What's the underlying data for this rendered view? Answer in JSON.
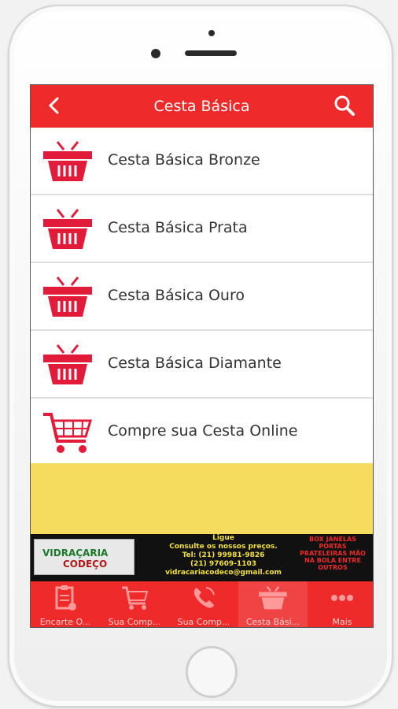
{
  "header": {
    "title": "Cesta Básica"
  },
  "list_items": [
    {
      "label": "Cesta Básica Bronze",
      "icon": "basket-icon"
    },
    {
      "label": "Cesta Básica Prata",
      "icon": "basket-icon"
    },
    {
      "label": "Cesta Básica Ouro",
      "icon": "basket-icon"
    },
    {
      "label": "Cesta Básica Diamante",
      "icon": "basket-icon"
    },
    {
      "label": "Compre sua Cesta Online",
      "icon": "cart-icon"
    }
  ],
  "banner": {
    "brand_line1": "VIDRAÇARIA",
    "brand_line2": "CODEÇO",
    "line1": "Ligue",
    "line2": "Consulte os nossos preços.",
    "line3": "Tel: (21) 99981-9826",
    "line4": "(21) 97609-1103",
    "line5": "vidracariacodeco@gmail.com",
    "right_text": "BOX JANELAS PORTAS PRATELEIRAS MÃO NA BOLA ENTRE OUTROS"
  },
  "tabs": [
    {
      "label": "Encarte O...",
      "icon": "clipboard-icon"
    },
    {
      "label": "Sua Comp...",
      "icon": "cart-icon"
    },
    {
      "label": "Sua Comp...",
      "icon": "phone-icon"
    },
    {
      "label": "Cesta Bási...",
      "icon": "basket-icon"
    },
    {
      "label": "Mais",
      "icon": "more-icon"
    }
  ],
  "colors": {
    "accent": "#ee2a2a",
    "yellow": "#f5dc5e"
  }
}
